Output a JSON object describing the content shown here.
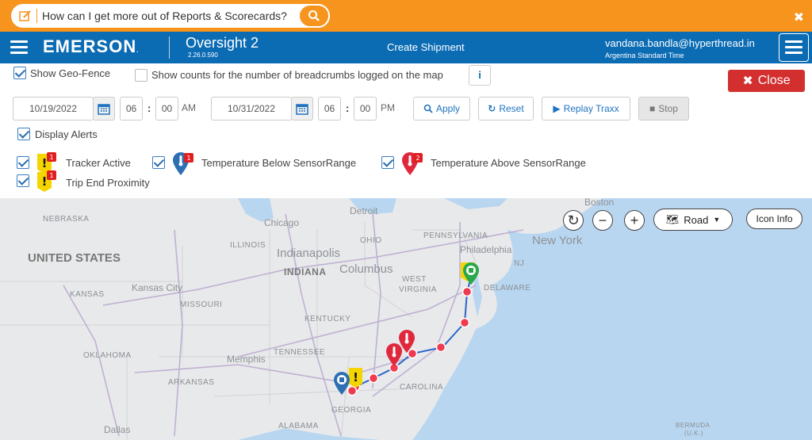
{
  "help": {
    "question": "How can I get more out of Reports & Scorecards?"
  },
  "nav": {
    "brand": "EMERSON",
    "trademark": ".",
    "app_name": "Oversight 2",
    "app_version": "2.26.0.590",
    "center_title": "Create Shipment",
    "user_email": "vandana.bandla@hyperthread.in",
    "timezone": "Argentina Standard Time"
  },
  "options": {
    "geo_fence_label": "Show Geo-Fence",
    "geo_fence_checked": true,
    "breadcrumbs_label": "Show counts for the number of breadcrumbs logged on the map",
    "breadcrumbs_checked": false,
    "info_label": "i",
    "close_label": "Close"
  },
  "filters": {
    "start_date": "10/19/2022",
    "start_hour": "06",
    "start_min": "00",
    "start_ampm": "AM",
    "colon": ":",
    "end_date": "10/31/2022",
    "end_hour": "06",
    "end_min": "00",
    "end_ampm": "PM",
    "apply_label": "Apply",
    "reset_label": "Reset",
    "replay_label": "Replay Traxx",
    "stop_label": "Stop"
  },
  "alerts": {
    "display_label": "Display Alerts",
    "items": [
      {
        "label": "Tracker Active",
        "count": "1"
      },
      {
        "label": "Temperature Below SensorRange",
        "count": "1"
      },
      {
        "label": "Temperature Above SensorRange",
        "count": "2"
      },
      {
        "label": "Trip End Proximity",
        "count": "1"
      }
    ]
  },
  "map": {
    "road_label": "Road",
    "icon_info_label": "Icon Info",
    "labels": {
      "nebraska": "NEBRASKA",
      "united_states": "UNITED STATES",
      "kansas": "KANSAS",
      "kansas_city": "Kansas City",
      "missouri": "MISSOURI",
      "illinois": "ILLINOIS",
      "chicago": "Chicago",
      "detroit": "Detroit",
      "indianapolis": "Indianapolis",
      "indiana": "INDIANA",
      "ohio": "OHIO",
      "columbus": "Columbus",
      "pennsylvania": "PENNSYLVANIA",
      "new_york": "New York",
      "philadelphia": "Philadelphia",
      "boston": "Boston",
      "nj": "NJ",
      "west_virginia_1": "WEST",
      "west_virginia_2": "VIRGINIA",
      "kentucky": "KENTUCKY",
      "delaware": "DELAWARE",
      "tennessee": "TENNESSEE",
      "memphis": "Memphis",
      "oklahoma": "OKLAHOMA",
      "arkansas": "ARKANSAS",
      "carolina": "CAROLINA",
      "georgia": "GEORGIA",
      "alabama": "ALABAMA",
      "dallas": "Dallas",
      "bermuda": "BERMUDA",
      "bermuda_uk": "(U.K.)"
    }
  }
}
